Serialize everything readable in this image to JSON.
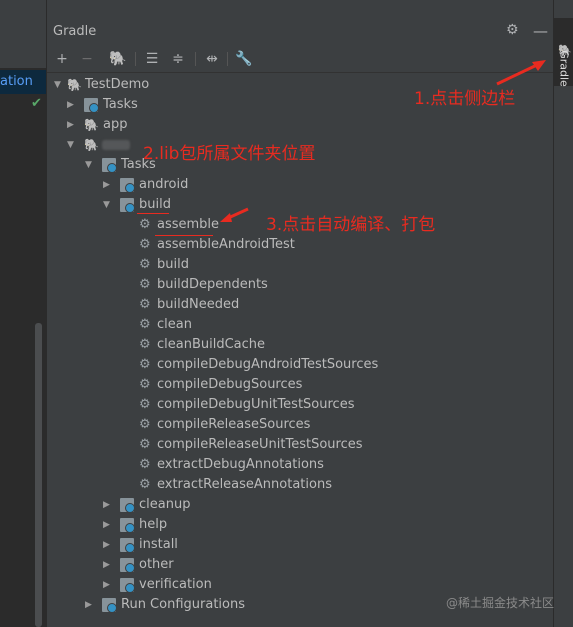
{
  "left": {
    "selected_text": "ation",
    "check_icon": "check-icon"
  },
  "panel": {
    "title": "Gradle",
    "toolbar": [
      "add-icon",
      "remove-icon",
      "elephant-icon",
      "expand-all-icon",
      "collapse-all-icon",
      "toggle-offline-icon",
      "wrench-icon"
    ]
  },
  "tree": {
    "root": "TestDemo",
    "tasks": "Tasks",
    "app": "app",
    "module_tasks": "Tasks",
    "android": "android",
    "build": "build",
    "build_tasks": [
      "assemble",
      "assembleAndroidTest",
      "build",
      "buildDependents",
      "buildNeeded",
      "clean",
      "cleanBuildCache",
      "compileDebugAndroidTestSources",
      "compileDebugSources",
      "compileDebugUnitTestSources",
      "compileReleaseSources",
      "compileReleaseUnitTestSources",
      "extractDebugAnnotations",
      "extractReleaseAnnotations"
    ],
    "groups": [
      "cleanup",
      "help",
      "install",
      "other",
      "verification"
    ],
    "run_configs": "Run Configurations"
  },
  "annotations": {
    "a1": "1.点击侧边栏",
    "a2": "2.lib包所属文件夹位置",
    "a3": "3.点击自动编译、打包"
  },
  "right_tab": "Gradle",
  "watermark": "@稀土掘金技术社区",
  "colors": {
    "bg": "#3c3f41",
    "text": "#bbbbbb",
    "annotation": "#e82b20",
    "selection": "#589df6"
  }
}
